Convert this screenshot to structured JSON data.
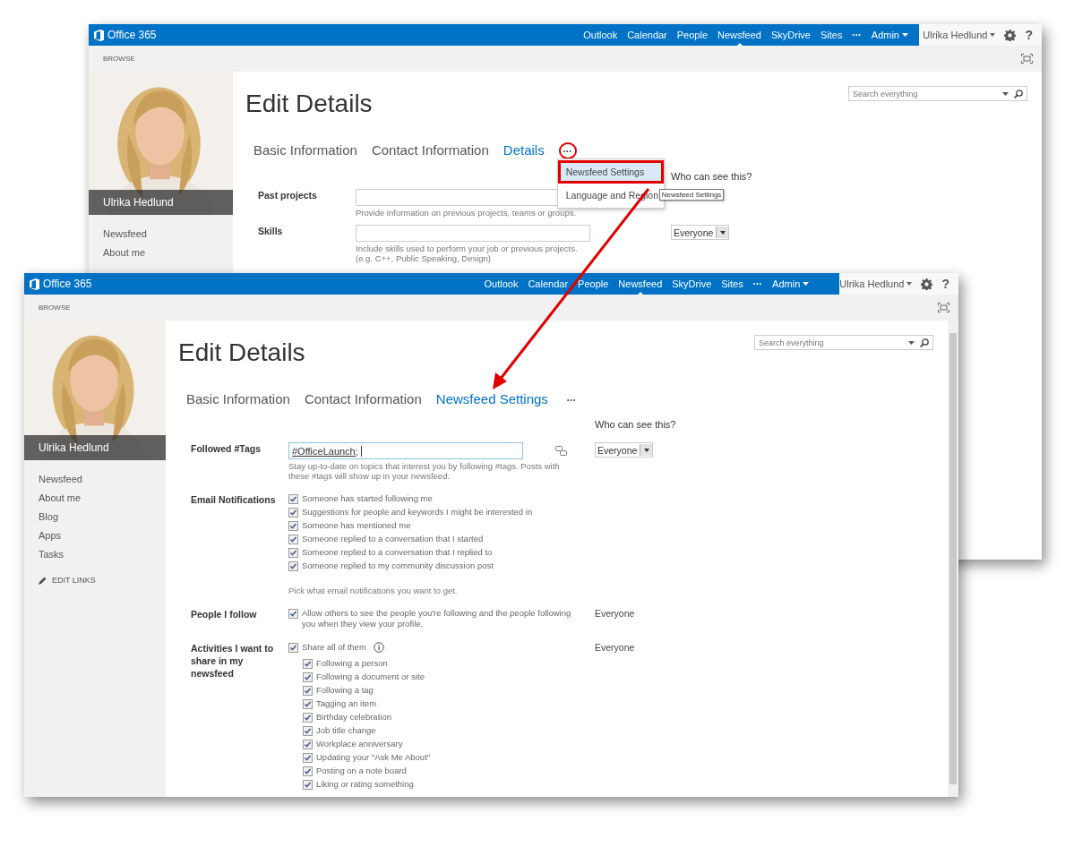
{
  "windows": [
    {
      "kind": "back",
      "nav": {
        "logo": "Office 365",
        "links": [
          {
            "label": "Outlook",
            "kind": "link",
            "selected": false
          },
          {
            "label": "Calendar",
            "kind": "link",
            "selected": false
          },
          {
            "label": "People",
            "kind": "link",
            "selected": false
          },
          {
            "label": "Newsfeed",
            "kind": "link",
            "selected": true
          },
          {
            "label": "SkyDrive",
            "kind": "link",
            "selected": false
          },
          {
            "label": "Sites",
            "kind": "link",
            "selected": false
          },
          {
            "label": "•••",
            "kind": "more",
            "selected": false
          },
          {
            "label": "Admin",
            "kind": "menu",
            "selected": false
          }
        ],
        "user": "Ulrika Hedlund",
        "help": "?"
      },
      "ribbon_tab": "BROWSE",
      "profile": {
        "kind": "picture",
        "name": "Ulrika Hedlund"
      },
      "sidebar": {
        "items": [
          "Newsfeed",
          "About me"
        ]
      },
      "page_title": "Edit Details",
      "search": {
        "placeholder": "Search everything"
      },
      "tabs": [
        {
          "label": "Basic Information",
          "selected": false
        },
        {
          "label": "Contact Information",
          "selected": false
        },
        {
          "label": "Details",
          "selected": true
        }
      ],
      "more_tab": {
        "label": "•••",
        "annotated": true
      },
      "menu": {
        "items": [
          {
            "label": "Newsfeed Settings",
            "highlighted": true,
            "annotated": true
          },
          {
            "label": "Language and Region",
            "highlighted": false,
            "annotated": false
          }
        ],
        "tooltip": "Newsfeed Settings"
      },
      "visibility_heading": "Who can see this?",
      "fields": [
        {
          "kind": "text",
          "label": "Past projects",
          "hint": "Provide information on previous projects, teams or groups."
        },
        {
          "kind": "text",
          "label": "Skills",
          "hint": "Include skills used to perform your job or previous projects. (e.g. C++, Public Speaking, Design)",
          "visibility": {
            "kind": "dropdown",
            "value": "Everyone"
          }
        }
      ]
    },
    {
      "kind": "front",
      "nav": {
        "logo": "Office 365",
        "links": [
          {
            "label": "Outlook",
            "kind": "link",
            "selected": false
          },
          {
            "label": "Calendar",
            "kind": "link",
            "selected": false
          },
          {
            "label": "People",
            "kind": "link",
            "selected": false
          },
          {
            "label": "Newsfeed",
            "kind": "link",
            "selected": true
          },
          {
            "label": "SkyDrive",
            "kind": "link",
            "selected": false
          },
          {
            "label": "Sites",
            "kind": "link",
            "selected": false
          },
          {
            "label": "•••",
            "kind": "more",
            "selected": false
          },
          {
            "label": "Admin",
            "kind": "menu",
            "selected": false
          }
        ],
        "user": "Ulrika Hedlund",
        "help": "?"
      },
      "ribbon_tab": "BROWSE",
      "profile": {
        "kind": "picture",
        "name": "Ulrika Hedlund"
      },
      "sidebar": {
        "items": [
          "Newsfeed",
          "About me",
          "Blog",
          "Apps",
          "Tasks"
        ],
        "edit_links": "EDIT LINKS"
      },
      "page_title": "Edit Details",
      "search": {
        "placeholder": "Search everything"
      },
      "tabs": [
        {
          "label": "Basic Information",
          "selected": false
        },
        {
          "label": "Contact Information",
          "selected": false
        },
        {
          "label": "Newsfeed Settings",
          "selected": true
        }
      ],
      "more_tab": {
        "label": "•••",
        "annotated": false
      },
      "visibility_heading": "Who can see this?",
      "fields": [
        {
          "kind": "tags",
          "label": "Followed #Tags",
          "value": "#OfficeLaunch;",
          "hint": "Stay up-to-date on topics that interest you by following #tags. Posts with these #tags will show up in your newsfeed.",
          "visibility": {
            "kind": "dropdown",
            "value": "Everyone"
          }
        },
        {
          "kind": "checklist",
          "label": "Email Notifications",
          "items": [
            {
              "label": "Someone has started following me",
              "checked": true
            },
            {
              "label": "Suggestions for people and keywords I might be interested in",
              "checked": true
            },
            {
              "label": "Someone has mentioned me",
              "checked": true
            },
            {
              "label": "Someone replied to a conversation that I started",
              "checked": true
            },
            {
              "label": "Someone replied to a conversation that I replied to",
              "checked": true
            },
            {
              "label": "Someone replied to my community discussion post",
              "checked": true
            }
          ],
          "note": "Pick what email notifications you want to get."
        },
        {
          "kind": "checklist",
          "label": "People I follow",
          "items": [
            {
              "label": "Allow others to see the people you're following and the people following you when they view your profile.",
              "checked": true
            }
          ],
          "visibility": {
            "kind": "text",
            "value": "Everyone"
          }
        },
        {
          "kind": "checklist",
          "label": "Activities I want to share in my newsfeed",
          "items": [
            {
              "label": "Share all of them",
              "checked": true,
              "info": true,
              "children": [
                {
                  "label": "Following a person",
                  "checked": true
                },
                {
                  "label": "Following a document or site",
                  "checked": true
                },
                {
                  "label": "Following a tag",
                  "checked": true
                },
                {
                  "label": "Tagging an item",
                  "checked": true
                },
                {
                  "label": "Birthday celebration",
                  "checked": true
                },
                {
                  "label": "Job title change",
                  "checked": true
                },
                {
                  "label": "Workplace anniversary",
                  "checked": true
                },
                {
                  "label": "Updating your \"Ask Me About\"",
                  "checked": true
                },
                {
                  "label": "Posting on a note board",
                  "checked": true
                },
                {
                  "label": "Liking or rating something",
                  "checked": true
                }
              ]
            }
          ],
          "visibility": {
            "kind": "text",
            "value": "Everyone"
          }
        }
      ]
    }
  ]
}
